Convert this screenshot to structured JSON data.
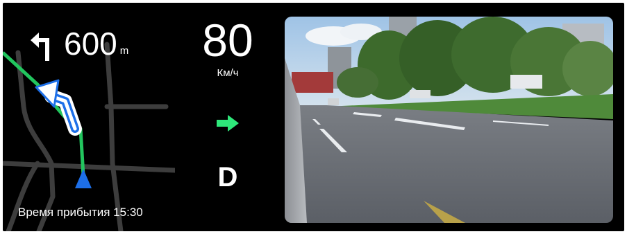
{
  "navigation": {
    "turn_icon": "turn-left-arrow-icon",
    "distance_value": "600",
    "distance_unit": "m",
    "arrival_text": "Время прибытия 15:30",
    "route_color": "#22c55e",
    "position_marker_color": "#1d6fe8"
  },
  "speed": {
    "value": "80",
    "unit": "Км/ч"
  },
  "direction_indicator": {
    "icon": "arrow-right-icon",
    "color": "#2ee87a"
  },
  "gear": {
    "value": "D"
  },
  "camera": {
    "view": "front-road-camera-feed"
  }
}
